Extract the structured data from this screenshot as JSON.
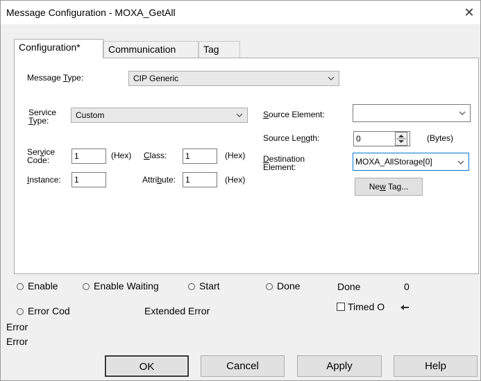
{
  "window": {
    "title": "Message Configuration - MOXA_GetAll",
    "close_glyph": "✕"
  },
  "tabs": [
    {
      "label": "Configuration*"
    },
    {
      "label": "Communication"
    },
    {
      "label": "Tag"
    }
  ],
  "config": {
    "message_type": {
      "label_pre": "Message ",
      "label_u": "T",
      "label_post": "ype:",
      "value": "CIP Generic"
    },
    "service_type": {
      "label_line1": "Service",
      "label_u": "T",
      "label_line2_post": "ype:",
      "value": "Custom"
    },
    "service_code": {
      "label_line1_pre": "Ser",
      "label_u": "v",
      "label_line1_post": "ice",
      "label_line2": "Code:",
      "value": "1",
      "unit": "(Hex)"
    },
    "class": {
      "label_u": "C",
      "label_post": "lass:",
      "value": "1",
      "unit": "(Hex)"
    },
    "instance": {
      "label_u": "I",
      "label_post": "nstance:",
      "value": "1"
    },
    "attribute": {
      "label_pre": "Attri",
      "label_u": "b",
      "label_post": "ute:",
      "value": "1",
      "unit": "(Hex)"
    },
    "source_element": {
      "label_u": "S",
      "label_post": "ource Element:",
      "value": ""
    },
    "source_length": {
      "label_pre": "Source Le",
      "label_u": "n",
      "label_post": "gth:",
      "value": "0",
      "unit": "(Bytes)"
    },
    "destination_element": {
      "label_u": "D",
      "label_post": "estination",
      "label_line2": "Element:",
      "value": "MOXA_AllStorage[0]"
    },
    "new_tag": {
      "label_pre": "Ne",
      "label_u": "w",
      "label_post": " Tag..."
    }
  },
  "status": {
    "enable": "Enable",
    "enable_waiting": "Enable Waiting",
    "start": "Start",
    "done": "Done",
    "done_length_label": "Done",
    "done_length_value": "0",
    "error_code": "Error Cod",
    "extended_error": "Extended Error",
    "timed_out": "Timed O",
    "error_line1": "Error",
    "error_line2": "Error"
  },
  "buttons": {
    "ok": "OK",
    "cancel": "Cancel",
    "apply": "Apply",
    "help": "Help"
  }
}
